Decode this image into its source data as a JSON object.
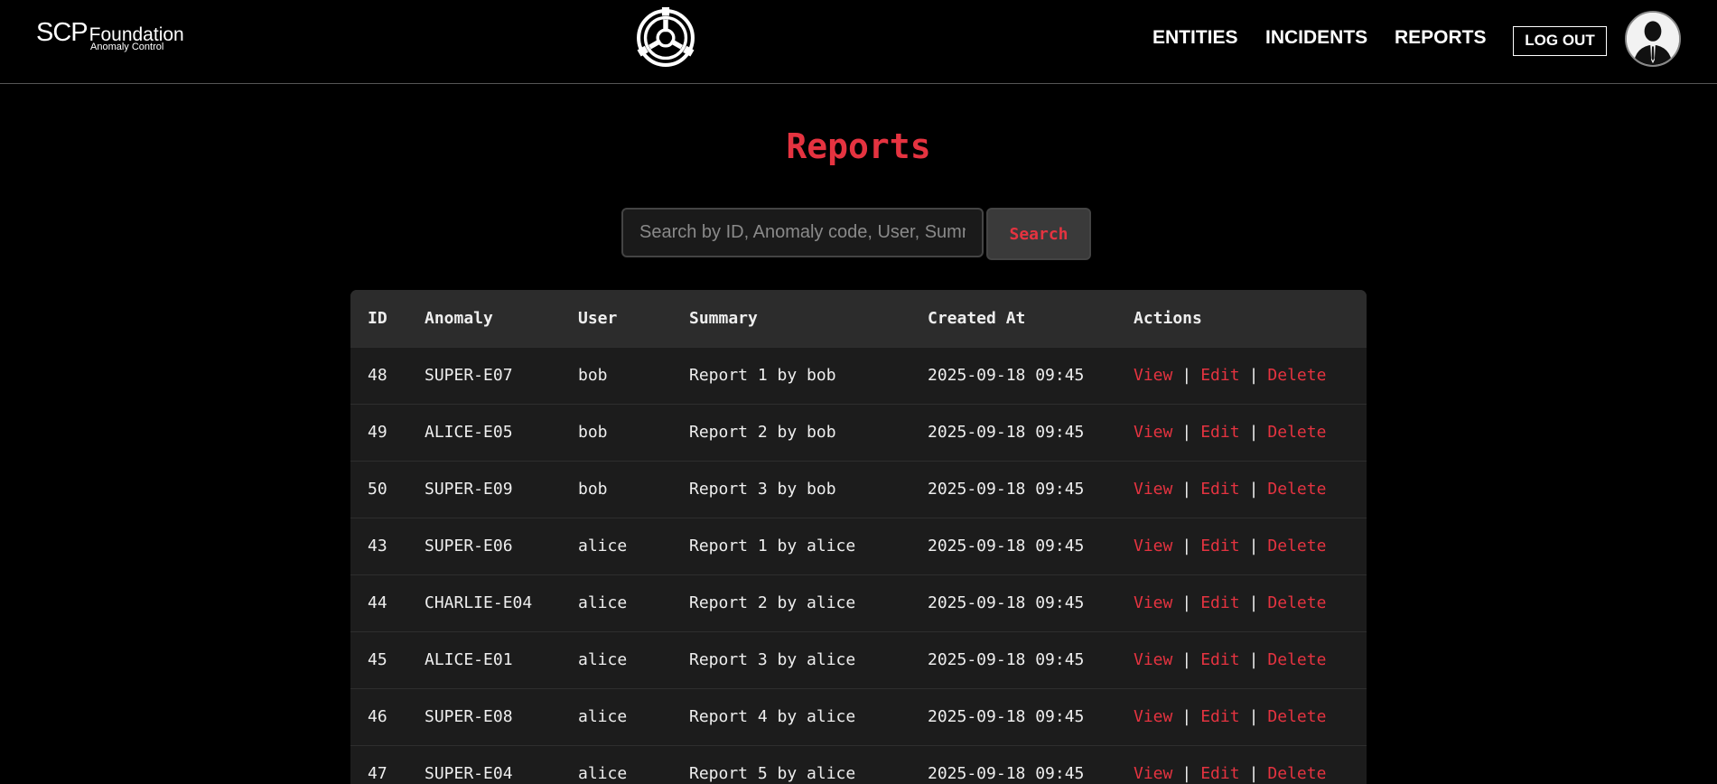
{
  "brand": {
    "scp": "SCP",
    "foundation": "Foundation",
    "subtitle": "Anomaly Control"
  },
  "nav": {
    "entities": "ENTITIES",
    "incidents": "INCIDENTS",
    "reports": "REPORTS",
    "logout": "LOG OUT"
  },
  "page": {
    "title": "Reports"
  },
  "search": {
    "placeholder": "Search by ID, Anomaly code, User, Summary",
    "button": "Search"
  },
  "table": {
    "headers": {
      "id": "ID",
      "anomaly": "Anomaly",
      "user": "User",
      "summary": "Summary",
      "created": "Created At",
      "actions": "Actions"
    },
    "actions": {
      "view": "View",
      "edit": "Edit",
      "delete": "Delete",
      "sep": "|"
    },
    "rows": [
      {
        "id": "48",
        "anomaly": "SUPER-E07",
        "user": "bob",
        "summary": "Report 1 by bob",
        "created": "2025-09-18 09:45"
      },
      {
        "id": "49",
        "anomaly": "ALICE-E05",
        "user": "bob",
        "summary": "Report 2 by bob",
        "created": "2025-09-18 09:45"
      },
      {
        "id": "50",
        "anomaly": "SUPER-E09",
        "user": "bob",
        "summary": "Report 3 by bob",
        "created": "2025-09-18 09:45"
      },
      {
        "id": "43",
        "anomaly": "SUPER-E06",
        "user": "alice",
        "summary": "Report 1 by alice",
        "created": "2025-09-18 09:45"
      },
      {
        "id": "44",
        "anomaly": "CHARLIE-E04",
        "user": "alice",
        "summary": "Report 2 by alice",
        "created": "2025-09-18 09:45"
      },
      {
        "id": "45",
        "anomaly": "ALICE-E01",
        "user": "alice",
        "summary": "Report 3 by alice",
        "created": "2025-09-18 09:45"
      },
      {
        "id": "46",
        "anomaly": "SUPER-E08",
        "user": "alice",
        "summary": "Report 4 by alice",
        "created": "2025-09-18 09:45"
      },
      {
        "id": "47",
        "anomaly": "SUPER-E04",
        "user": "alice",
        "summary": "Report 5 by alice",
        "created": "2025-09-18 09:45"
      }
    ]
  },
  "colors": {
    "accent": "#e53340",
    "background": "#000000",
    "table_bg": "#1c1c1c",
    "header_bg": "#2c2c2c"
  },
  "icons": {
    "logo": "scp-logo-icon",
    "avatar": "user-avatar-icon"
  }
}
